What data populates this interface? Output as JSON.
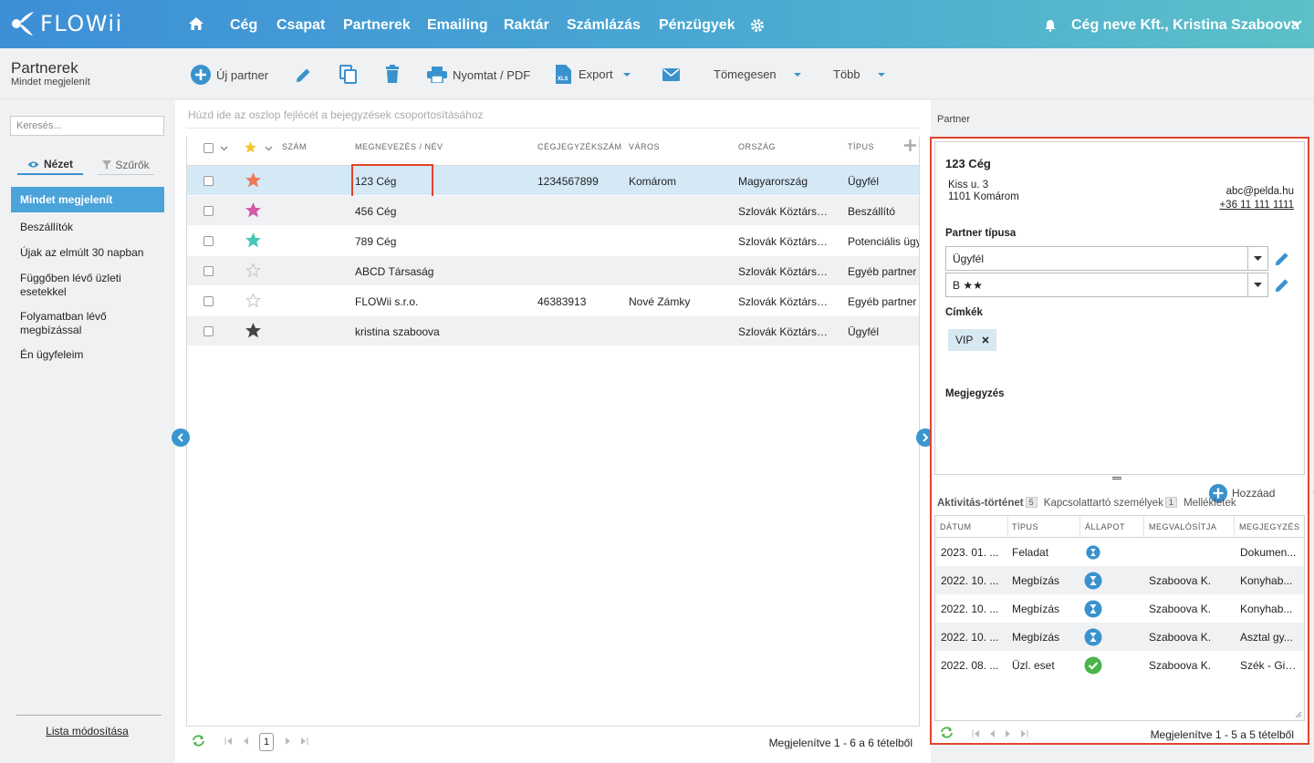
{
  "app": {
    "logo": "FLOWii"
  },
  "nav": {
    "items": [
      "Cég",
      "Csapat",
      "Partnerek",
      "Emailing",
      "Raktár",
      "Számlázás",
      "Pénzügyek"
    ],
    "user": "Cég neve Kft., Kristina Szaboova"
  },
  "page": {
    "title": "Partnerek",
    "subtitle": "Mindet megjelenít"
  },
  "toolbar": {
    "new_partner": "Új partner",
    "print": "Nyomtat / PDF",
    "export": "Export",
    "bulk": "Tömegesen",
    "more": "Több"
  },
  "sidebar": {
    "search_placeholder": "Keresés...",
    "tab_view": "Nézet",
    "tab_filter": "Szűrők",
    "items": [
      "Mindet megjelenít",
      "Beszállítók",
      "Újak az elmúlt 30 napban",
      "Függőben lévő üzleti esetekkel",
      "Folyamatban lévő megbízással",
      "Én ügyfeleim"
    ],
    "edit_list": "Lista módosítása"
  },
  "grid": {
    "group_hint": "Húzd ide az oszlop fejlécét a bejegyzések csoportosításához",
    "columns": [
      "Szám",
      "Megnevezés / Név",
      "Cégjegyzékszám",
      "Város",
      "Ország",
      "Típus"
    ],
    "rows": [
      {
        "name": "123 Cég",
        "reg": "1234567899",
        "city": "Komárom",
        "country": "Magyarország",
        "type": "Ügyfél",
        "star": "#ee7a5a"
      },
      {
        "name": "456 Cég",
        "reg": "",
        "city": "",
        "country": "Szlovák Köztársaság",
        "type": "Beszállító",
        "star": "#d05aa6"
      },
      {
        "name": "789 Cég",
        "reg": "",
        "city": "",
        "country": "Szlovák Köztársaság",
        "type": "Potenciális ügyfél",
        "star": "#45c8b5"
      },
      {
        "name": "ABCD Társaság",
        "reg": "",
        "city": "",
        "country": "Szlovák Köztársaság",
        "type": "Egyéb partner",
        "star": "none"
      },
      {
        "name": "FLOWii s.r.o.",
        "reg": "46383913",
        "city": "Nové Zámky",
        "country": "Szlovák Köztársaság",
        "type": "Egyéb partner",
        "star": "none"
      },
      {
        "name": "kristina szaboova",
        "reg": "",
        "city": "",
        "country": "Szlovák Köztársaság",
        "type": "Ügyfél",
        "star": "#444444"
      }
    ],
    "page": "1",
    "status": "Megjelenítve 1 - 6 a 6 tételből"
  },
  "detail": {
    "section_label": "Partner",
    "name": "123 Cég",
    "address_line1": "Kiss u. 3",
    "address_line2": "1101 Komárom",
    "email": "abc@pelda.hu",
    "phone": "+36 11 111 1111",
    "partner_type_label": "Partner típusa",
    "partner_type": "Ügyfél",
    "rating": "B ★★",
    "tags_label": "Címkék",
    "tag": "VIP",
    "note_label": "Megjegyzés",
    "add_label": "Hozzáad",
    "tabs": [
      {
        "label": "Aktivitás-történet",
        "count": "5"
      },
      {
        "label": "Kapcsolattartó személyek",
        "count": "1"
      },
      {
        "label": "Mellékletek",
        "count": ""
      }
    ],
    "columns": [
      "Dátum",
      "Típus",
      "Állapot",
      "Megvalósítja",
      "Megjegyzés"
    ],
    "activities": [
      {
        "date": "2023. 01. ...",
        "type": "Feladat",
        "status": "pending-small",
        "owner": "",
        "note": "Dokumen..."
      },
      {
        "date": "2022. 10. ...",
        "type": "Megbízás",
        "status": "pending",
        "owner": "Szaboova K.",
        "note": "Konyhab..."
      },
      {
        "date": "2022. 10. ...",
        "type": "Megbízás",
        "status": "pending",
        "owner": "Szaboova K.",
        "note": "Konyhab..."
      },
      {
        "date": "2022. 10. ...",
        "type": "Megbízás",
        "status": "pending",
        "owner": "Szaboova K.",
        "note": "Asztal gy..."
      },
      {
        "date": "2022. 08. ...",
        "type": "Üzl. eset",
        "status": "done",
        "owner": "Szaboova K.",
        "note": "Szék - Gio..."
      }
    ],
    "status": "Megjelenítve 1 - 5 a 5 tételből"
  },
  "colors": {
    "accent": "#3a92cd",
    "highlight": "#e0442c",
    "selected_row": "#d4e8f6",
    "done": "#4ab34a"
  }
}
